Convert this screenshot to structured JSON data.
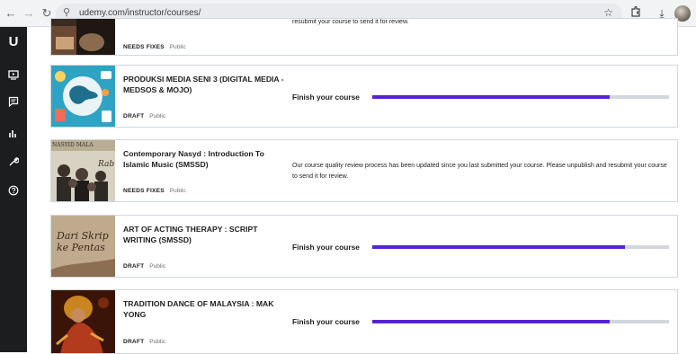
{
  "browser": {
    "url": "udemy.com/instructor/courses/",
    "icons": [
      "back-icon",
      "forward-icon",
      "reload-icon",
      "site-info-icon",
      "bookmark-star-icon",
      "extensions-icon",
      "download-icon",
      "profile-avatar"
    ]
  },
  "sidebar": {
    "logo": "U",
    "icons": [
      "courses-icon",
      "communication-icon",
      "performance-icon",
      "tools-icon",
      "help-icon"
    ]
  },
  "courses": [
    {
      "title": "",
      "status": "NEEDS FIXES",
      "visibility": "Public",
      "message": "resubmit your course to send it for review."
    },
    {
      "title": "PRODUKSI MEDIA SENI 3 (DIGITAL MEDIA - MEDSOS & MOJO)",
      "status": "DRAFT",
      "visibility": "Public",
      "action": "Finish your course",
      "progress": 0.8
    },
    {
      "title": "Contemporary Nasyd : Introduction To Islamic Music (SMSSD)",
      "status": "NEEDS FIXES",
      "visibility": "Public",
      "message": "Our course quality review process has been updated since you last submitted your course. Please unpublish and resubmit your course to send it for review.",
      "thumb_text_top": "NASYID MALA",
      "thumb_text_mid": "Rab"
    },
    {
      "title": "ART OF ACTING THERAPY : SCRIPT WRITING (SMSSD)",
      "status": "DRAFT",
      "visibility": "Public",
      "action": "Finish your course",
      "progress": 0.85,
      "thumb_text": "Dari Skrip ke Pentas"
    },
    {
      "title": "TRADITION DANCE OF MALAYSIA : MAK YONG",
      "status": "DRAFT",
      "visibility": "Public",
      "action": "Finish your course",
      "progress": 0.8
    }
  ]
}
